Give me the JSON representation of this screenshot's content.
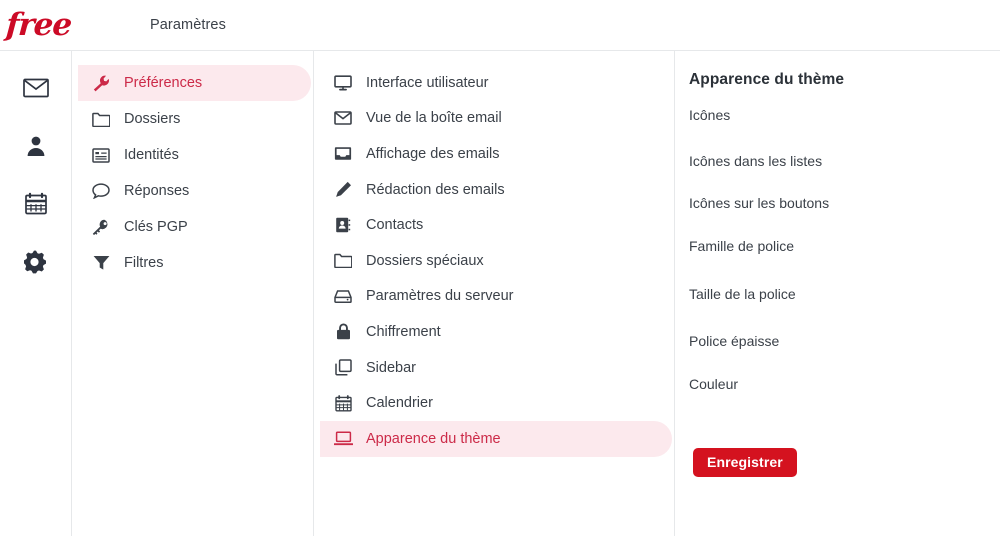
{
  "header": {
    "logo_text": "free",
    "title": "Paramètres"
  },
  "colors": {
    "brand_red": "#cc0a26",
    "accent_red": "#cc2a48",
    "highlight_pink": "#fce9ed",
    "button_red": "#d4121f",
    "text": "#3b4149",
    "divider": "#e6e8ea"
  },
  "rail": {
    "items": [
      {
        "name": "mail",
        "icon": "envelope-icon"
      },
      {
        "name": "contacts",
        "icon": "person-icon"
      },
      {
        "name": "calendar",
        "icon": "calendar-icon"
      },
      {
        "name": "settings",
        "icon": "gear-icon"
      }
    ]
  },
  "settings_nav": {
    "items": [
      {
        "label": "Préférences",
        "icon": "wrench-icon",
        "selected": true
      },
      {
        "label": "Dossiers",
        "icon": "folder-icon",
        "selected": false
      },
      {
        "label": "Identités",
        "icon": "identity-card-icon",
        "selected": false
      },
      {
        "label": "Réponses",
        "icon": "speech-bubble-icon",
        "selected": false
      },
      {
        "label": "Clés PGP",
        "icon": "key-icon",
        "selected": false
      },
      {
        "label": "Filtres",
        "icon": "funnel-icon",
        "selected": false
      }
    ]
  },
  "sections_nav": {
    "items": [
      {
        "label": "Interface utilisateur",
        "icon": "monitor-icon",
        "selected": false
      },
      {
        "label": "Vue de la boîte email",
        "icon": "envelope-icon",
        "selected": false
      },
      {
        "label": "Affichage des emails",
        "icon": "inbox-tray-icon",
        "selected": false
      },
      {
        "label": "Rédaction des emails",
        "icon": "pencil-icon",
        "selected": false
      },
      {
        "label": "Contacts",
        "icon": "address-book-icon",
        "selected": false
      },
      {
        "label": "Dossiers spéciaux",
        "icon": "folder-icon",
        "selected": false
      },
      {
        "label": "Paramètres du serveur",
        "icon": "server-icon",
        "selected": false
      },
      {
        "label": "Chiffrement",
        "icon": "lock-icon",
        "selected": false
      },
      {
        "label": "Sidebar",
        "icon": "panels-icon",
        "selected": false
      },
      {
        "label": "Calendrier",
        "icon": "calendar-icon",
        "selected": false
      },
      {
        "label": "Apparence du thème",
        "icon": "laptop-icon",
        "selected": true
      }
    ]
  },
  "panel": {
    "title": "Apparence du thème",
    "fields": [
      {
        "label": "Icônes"
      },
      {
        "label": "Icônes dans les listes"
      },
      {
        "label": "Icônes sur les boutons"
      },
      {
        "label": "Famille de police"
      },
      {
        "label": "Taille de la police"
      },
      {
        "label": "Police épaisse"
      },
      {
        "label": "Couleur"
      }
    ],
    "save_label": "Enregistrer"
  }
}
